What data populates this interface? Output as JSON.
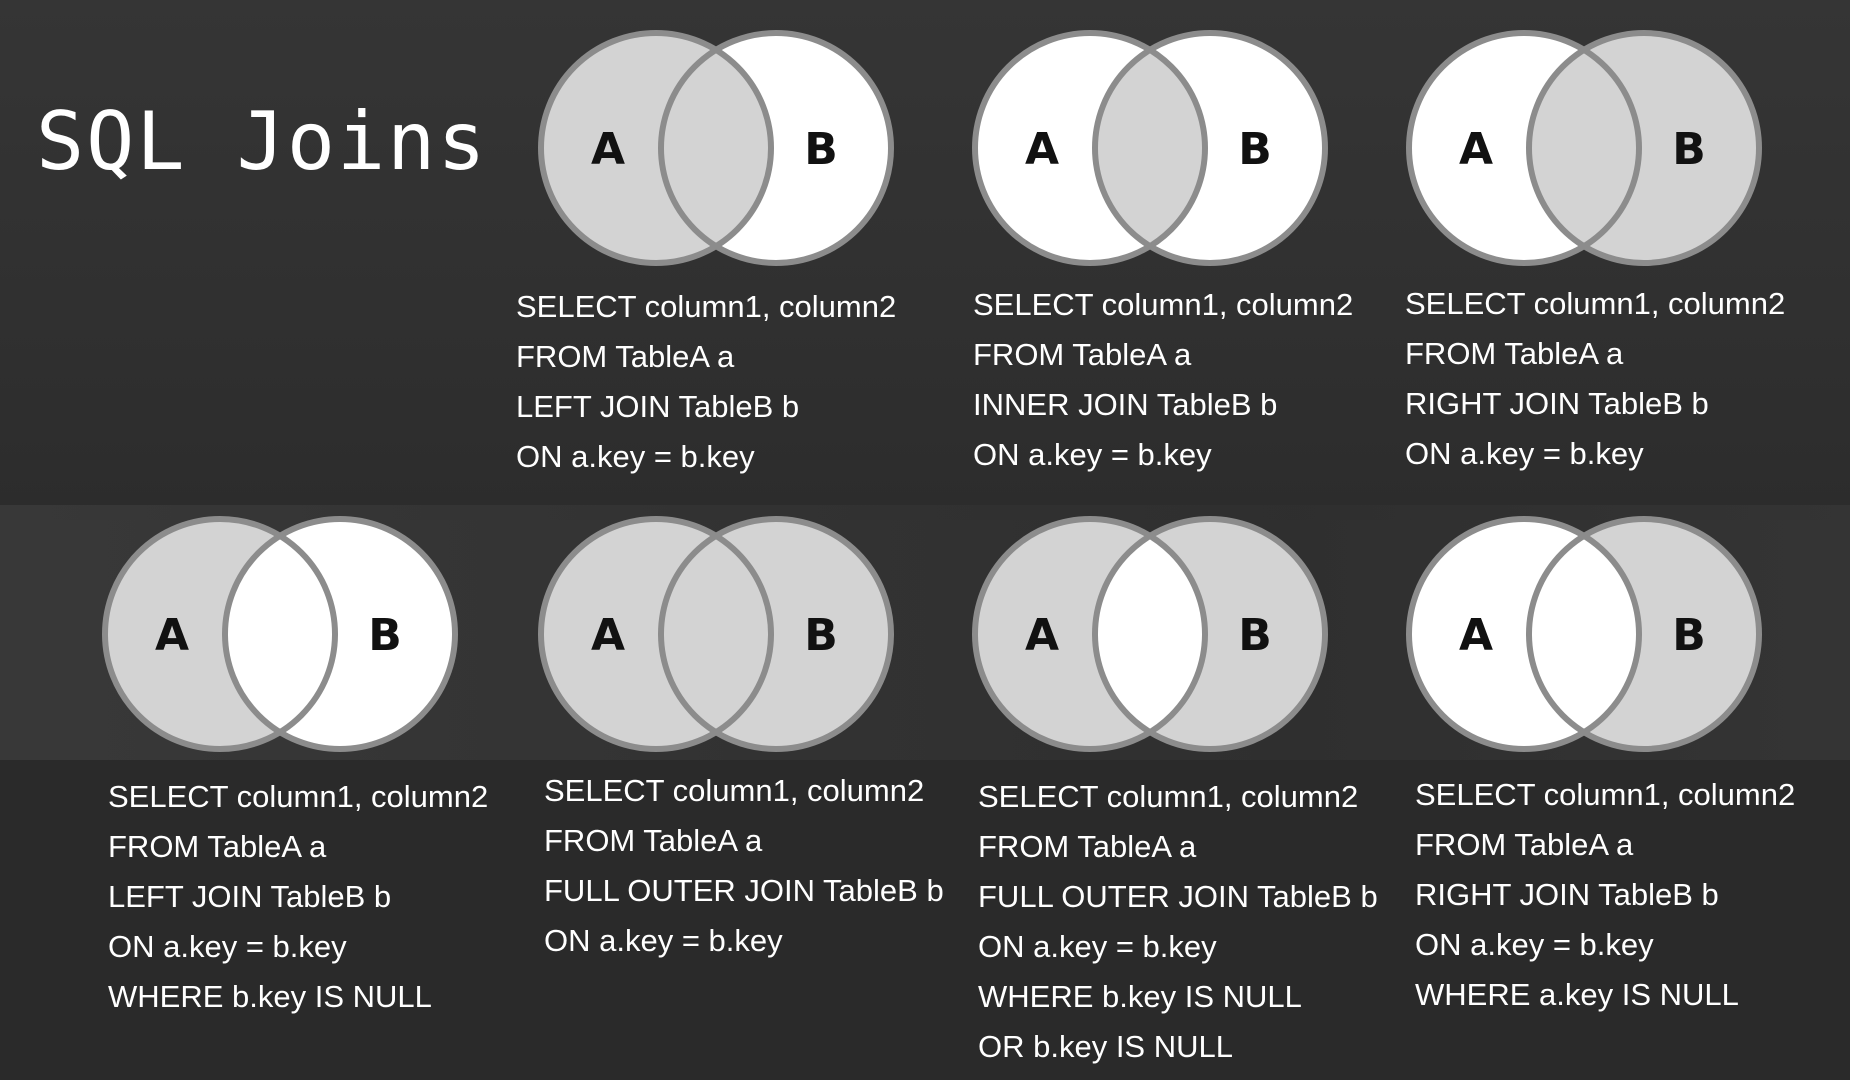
{
  "title": "SQL Joins",
  "colors": {
    "background": "#2f2f2f",
    "circle_filled": "#d3d3d3",
    "circle_empty": "#ffffff",
    "circle_stroke": "#8c8c8c",
    "label": "#111111",
    "text": "#ffffff"
  },
  "joins": [
    {
      "id": "left-join",
      "label_a": "A",
      "label_b": "B",
      "shade": {
        "a_only": true,
        "intersection": true,
        "b_only": false
      },
      "sql": [
        "SELECT column1, column2",
        "FROM TableA a",
        "LEFT JOIN TableB b",
        "ON a.key = b.key"
      ]
    },
    {
      "id": "inner-join",
      "label_a": "A",
      "label_b": "B",
      "shade": {
        "a_only": false,
        "intersection": true,
        "b_only": false
      },
      "sql": [
        "SELECT column1, column2",
        "FROM TableA a",
        "INNER JOIN TableB b",
        "ON a.key = b.key"
      ]
    },
    {
      "id": "right-join",
      "label_a": "A",
      "label_b": "B",
      "shade": {
        "a_only": false,
        "intersection": true,
        "b_only": true
      },
      "sql": [
        "SELECT column1, column2",
        "FROM TableA a",
        "RIGHT JOIN TableB b",
        "ON a.key = b.key"
      ]
    },
    {
      "id": "left-anti-join",
      "label_a": "A",
      "label_b": "B",
      "shade": {
        "a_only": true,
        "intersection": false,
        "b_only": false
      },
      "sql": [
        "SELECT column1, column2",
        "FROM TableA a",
        "LEFT JOIN TableB b",
        "ON a.key = b.key",
        "WHERE b.key IS NULL"
      ]
    },
    {
      "id": "full-outer-join",
      "label_a": "A",
      "label_b": "B",
      "shade": {
        "a_only": true,
        "intersection": true,
        "b_only": true
      },
      "sql": [
        "SELECT column1, column2",
        "FROM TableA a",
        "FULL OUTER JOIN TableB b",
        "ON a.key = b.key"
      ]
    },
    {
      "id": "full-outer-exclusive-join",
      "label_a": "A",
      "label_b": "B",
      "shade": {
        "a_only": true,
        "intersection": false,
        "b_only": true
      },
      "sql": [
        "SELECT column1, column2",
        "FROM TableA a",
        "FULL OUTER JOIN TableB b",
        "ON a.key = b.key",
        "WHERE b.key IS NULL",
        "OR b.key IS NULL"
      ]
    },
    {
      "id": "right-anti-join",
      "label_a": "A",
      "label_b": "B",
      "shade": {
        "a_only": false,
        "intersection": false,
        "b_only": true
      },
      "sql": [
        "SELECT column1, column2",
        "FROM TableA a",
        "RIGHT JOIN TableB b",
        "ON a.key = b.key",
        "WHERE a.key IS NULL"
      ]
    }
  ]
}
